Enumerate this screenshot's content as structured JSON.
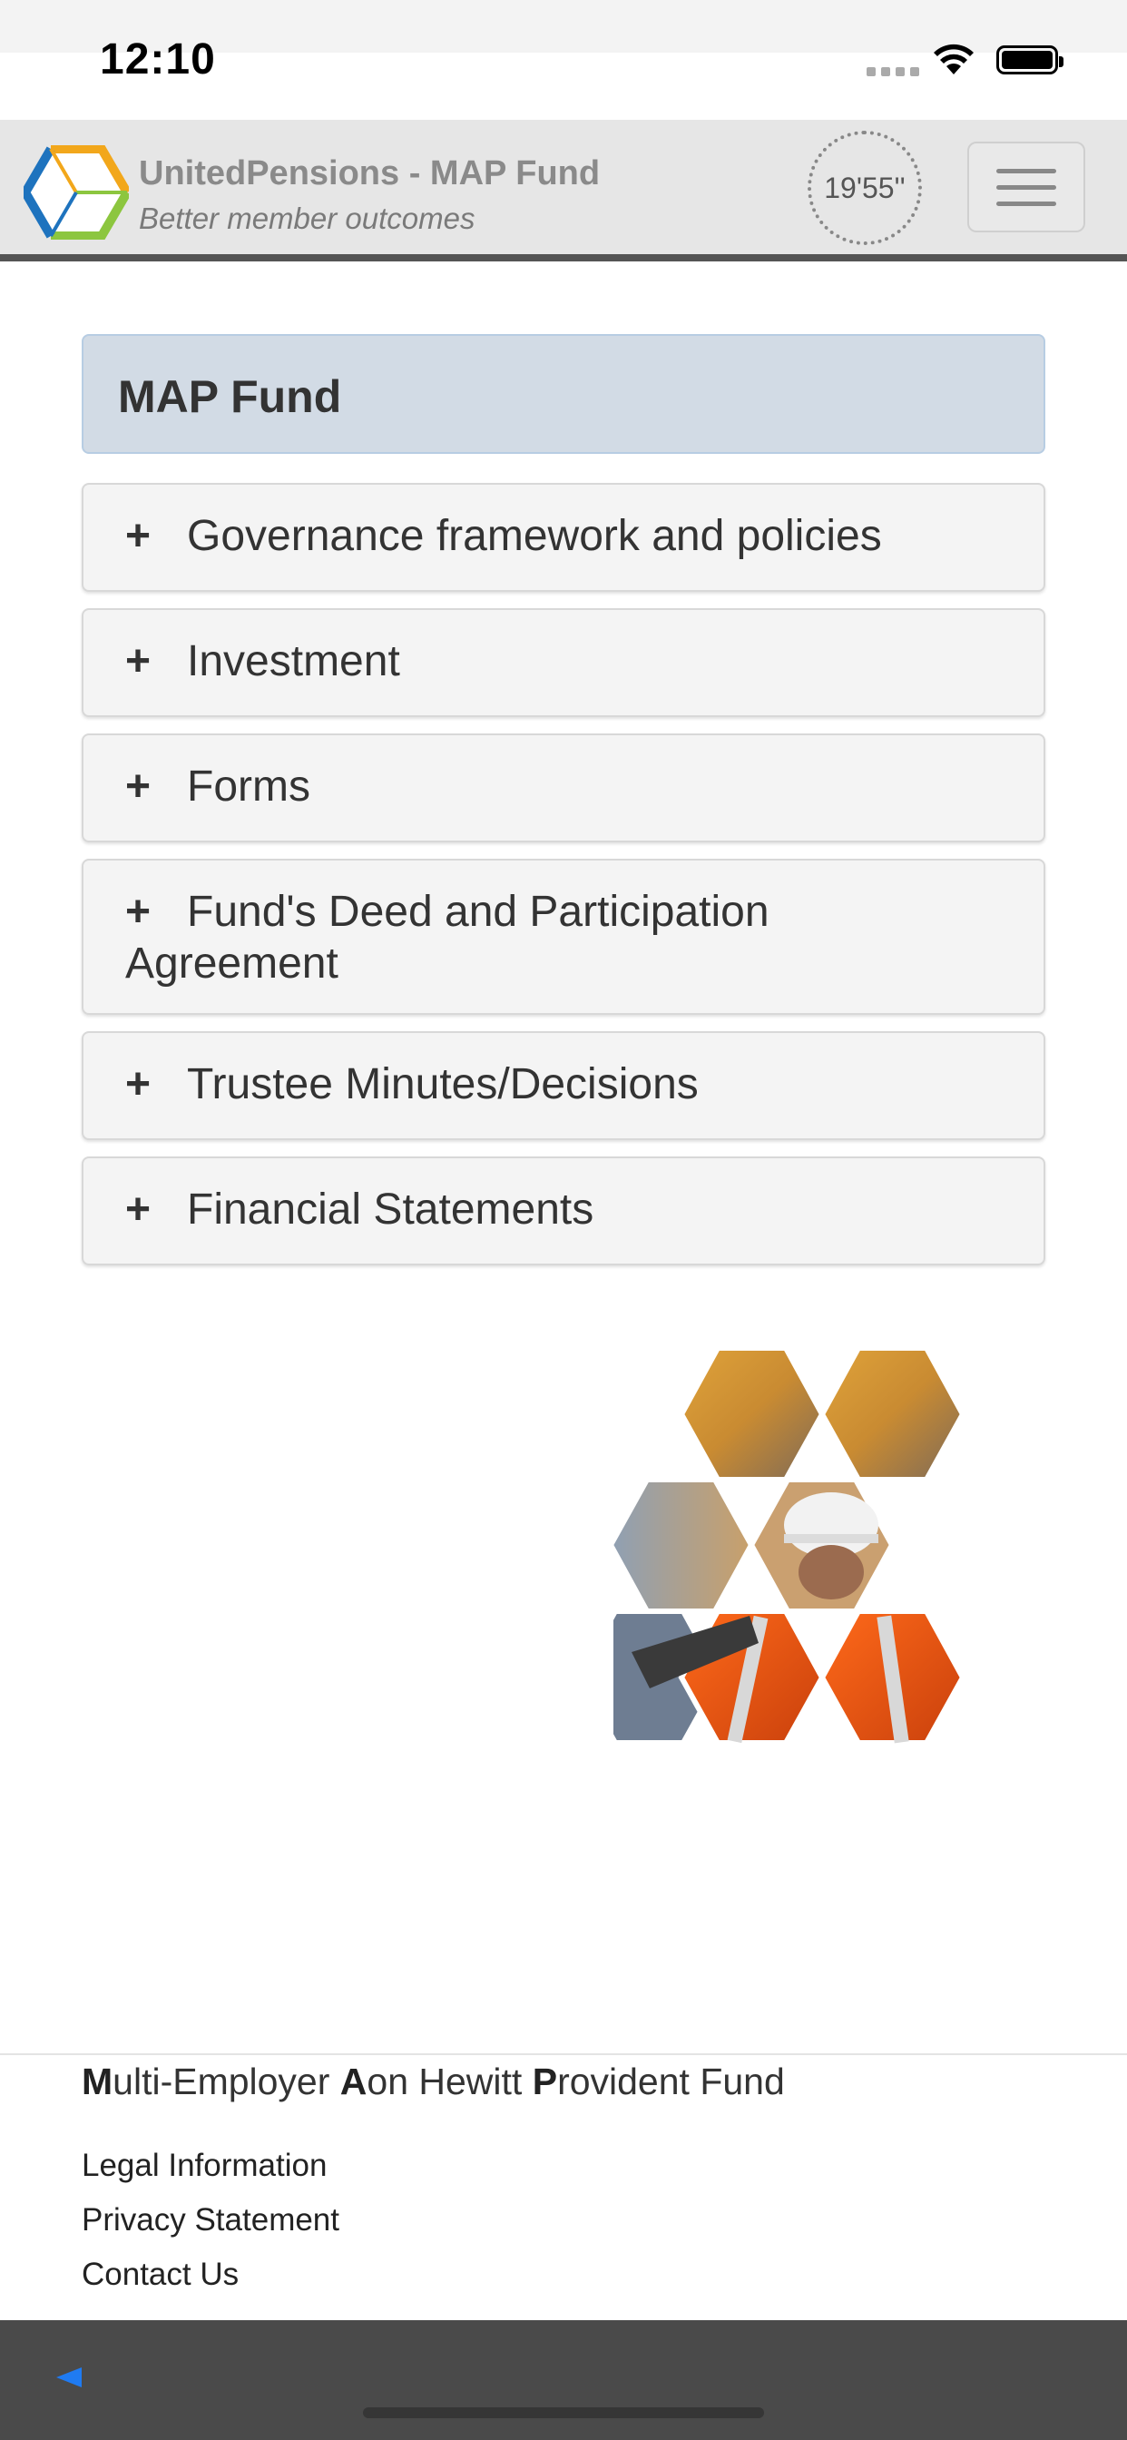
{
  "status_bar": {
    "time": "12:10"
  },
  "header": {
    "title": "UnitedPensions - MAP Fund",
    "subtitle": "Better member outcomes",
    "timer": "19'55''",
    "menu_icon": "hamburger-icon"
  },
  "main": {
    "heading": "MAP Fund",
    "sections": [
      {
        "label": "Governance framework and policies",
        "icon": "plus"
      },
      {
        "label": "Investment",
        "icon": "plus"
      },
      {
        "label": "Forms",
        "icon": "plus"
      },
      {
        "label": "Fund's Deed and Participation Agreement",
        "icon": "plus"
      },
      {
        "label": "Trustee Minutes/Decisions",
        "icon": "plus"
      },
      {
        "label": "Financial Statements",
        "icon": "plus"
      }
    ],
    "plus_symbol": "+"
  },
  "footer": {
    "fund_name_parts": [
      "M",
      "ulti-Employer ",
      "A",
      "on Hewitt ",
      "P",
      "rovident Fund"
    ],
    "links": [
      "Legal Information",
      "Privacy Statement",
      "Contact Us"
    ]
  },
  "colors": {
    "heading_bg": "#d2dbe5",
    "panel_bg": "#f4f4f4",
    "header_bg": "#e6e6e6",
    "back_arrow": "#1f7bf2"
  }
}
